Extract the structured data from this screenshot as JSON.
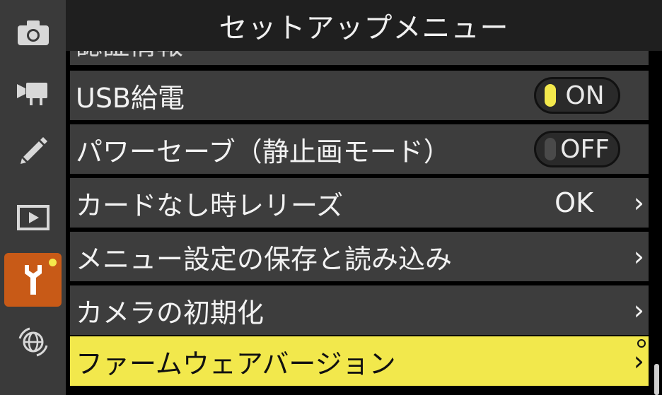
{
  "header": {
    "title": "セットアップメニュー"
  },
  "sidebar": {
    "items": [
      {
        "name": "photo-shooting-menu",
        "icon": "camera-icon"
      },
      {
        "name": "movie-shooting-menu",
        "icon": "movie-camera-icon"
      },
      {
        "name": "custom-settings-menu",
        "icon": "pencil-icon"
      },
      {
        "name": "playback-menu",
        "icon": "playback-icon"
      },
      {
        "name": "setup-menu",
        "icon": "wrench-icon",
        "active": true
      },
      {
        "name": "network-menu",
        "icon": "network-globe-icon"
      }
    ]
  },
  "menu": {
    "partial_item": "認証情報",
    "items": [
      {
        "label": "USB給電",
        "toggle": "ON",
        "toggle_on": true
      },
      {
        "label": "パワーセーブ（静止画モード）",
        "toggle": "OFF",
        "toggle_on": false
      },
      {
        "label": "カードなし時レリーズ",
        "value": "OK"
      },
      {
        "label": "メニュー設定の保存と読み込み"
      },
      {
        "label": "カメラの初期化"
      },
      {
        "label": "ファームウェアバージョン",
        "selected": true
      }
    ],
    "chevron": "›"
  },
  "colors": {
    "accent_active_tab": "#c85a17",
    "selection_yellow": "#f2e84c",
    "toggle_on_knob": "#f2e84c",
    "toggle_off_knob": "#4a4a4a"
  }
}
